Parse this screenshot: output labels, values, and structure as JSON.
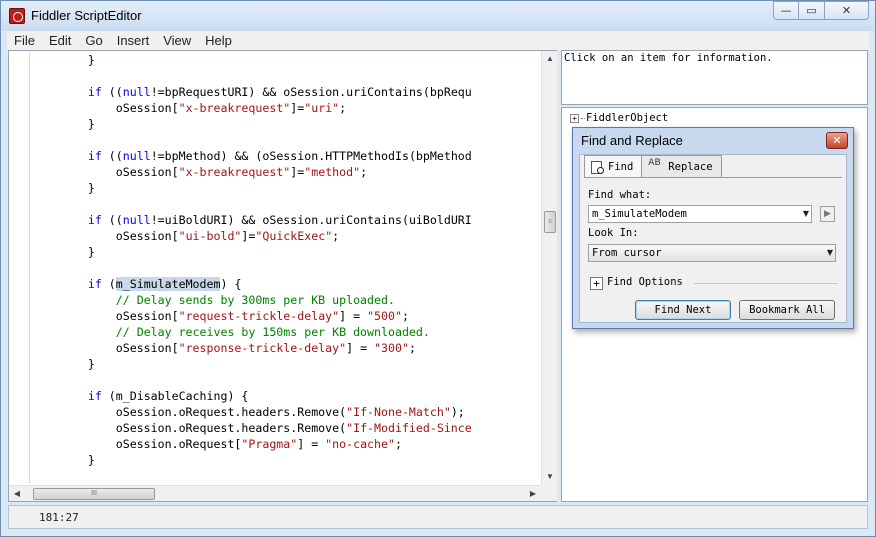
{
  "window": {
    "title": "Fiddler ScriptEditor",
    "caption": {
      "minimize": "—",
      "restore": "▭",
      "close": "✕"
    }
  },
  "menu": [
    "File",
    "Edit",
    "Go",
    "Insert",
    "View",
    "Help"
  ],
  "editor": {
    "lines": [
      [
        [
          "p",
          "        }"
        ]
      ],
      [
        [
          "p",
          ""
        ]
      ],
      [
        [
          "p",
          "        "
        ],
        [
          "kw",
          "if"
        ],
        [
          "p",
          " (("
        ],
        [
          "kw",
          "null"
        ],
        [
          "p",
          "!=bpRequestURI) && oSession.uriContains(bpRequ"
        ]
      ],
      [
        [
          "p",
          "            oSession["
        ],
        [
          "str",
          "\"x-breakrequest\""
        ],
        [
          "p",
          "]="
        ],
        [
          "str",
          "\"uri\""
        ],
        [
          "p",
          ";"
        ]
      ],
      [
        [
          "p",
          "        }"
        ]
      ],
      [
        [
          "p",
          ""
        ]
      ],
      [
        [
          "p",
          "        "
        ],
        [
          "kw",
          "if"
        ],
        [
          "p",
          " (("
        ],
        [
          "kw",
          "null"
        ],
        [
          "p",
          "!=bpMethod) && (oSession.HTTPMethodIs(bpMethod"
        ]
      ],
      [
        [
          "p",
          "            oSession["
        ],
        [
          "str",
          "\"x-breakrequest\""
        ],
        [
          "p",
          "]="
        ],
        [
          "str",
          "\"method\""
        ],
        [
          "p",
          ";"
        ]
      ],
      [
        [
          "p",
          "        }"
        ]
      ],
      [
        [
          "p",
          ""
        ]
      ],
      [
        [
          "p",
          "        "
        ],
        [
          "kw",
          "if"
        ],
        [
          "p",
          " (("
        ],
        [
          "kw",
          "null"
        ],
        [
          "p",
          "!=uiBoldURI) && oSession.uriContains(uiBoldURI"
        ]
      ],
      [
        [
          "p",
          "            oSession["
        ],
        [
          "str",
          "\"ui-bold\""
        ],
        [
          "p",
          "]="
        ],
        [
          "str",
          "\"QuickExec\""
        ],
        [
          "p",
          ";"
        ]
      ],
      [
        [
          "p",
          "        }"
        ]
      ],
      [
        [
          "p",
          ""
        ]
      ],
      [
        [
          "p",
          "        "
        ],
        [
          "kw",
          "if"
        ],
        [
          "p",
          " ("
        ],
        [
          "hl",
          "m_SimulateModem"
        ],
        [
          "p",
          ") {"
        ]
      ],
      [
        [
          "cmt",
          "            // Delay sends by 300ms per KB uploaded."
        ]
      ],
      [
        [
          "p",
          "            oSession["
        ],
        [
          "str",
          "\"request-trickle-delay\""
        ],
        [
          "p",
          "] = "
        ],
        [
          "str",
          "\"500\""
        ],
        [
          "p",
          ";"
        ]
      ],
      [
        [
          "cmt",
          "            // Delay receives by 150ms per KB downloaded."
        ]
      ],
      [
        [
          "p",
          "            oSession["
        ],
        [
          "str",
          "\"response-trickle-delay\""
        ],
        [
          "p",
          "] = "
        ],
        [
          "str",
          "\"300\""
        ],
        [
          "p",
          ";"
        ]
      ],
      [
        [
          "p",
          "        }"
        ]
      ],
      [
        [
          "p",
          ""
        ]
      ],
      [
        [
          "p",
          "        "
        ],
        [
          "kw",
          "if"
        ],
        [
          "p",
          " (m_DisableCaching) {"
        ]
      ],
      [
        [
          "p",
          "            oSession.oRequest.headers.Remove("
        ],
        [
          "str",
          "\"If-None-Match\""
        ],
        [
          "p",
          ");"
        ]
      ],
      [
        [
          "p",
          "            oSession.oRequest.headers.Remove("
        ],
        [
          "str",
          "\"If-Modified-Since"
        ]
      ],
      [
        [
          "p",
          "            oSession.oRequest["
        ],
        [
          "str",
          "\"Pragma\""
        ],
        [
          "p",
          "] = "
        ],
        [
          "str",
          "\"no-cache\""
        ],
        [
          "p",
          ";"
        ]
      ],
      [
        [
          "p",
          "        }"
        ]
      ],
      [
        [
          "p",
          ""
        ]
      ]
    ]
  },
  "scroll": {
    "up": "▲",
    "down": "▼",
    "left": "◀",
    "right": "▶",
    "grip_v": "≡",
    "grip_h": "III"
  },
  "info_panel": {
    "text": "Click on an item for information."
  },
  "tree": {
    "root": "FiddlerObject",
    "expander": "+"
  },
  "status": {
    "position": "181:27"
  },
  "dialog": {
    "title": "Find and Replace",
    "close": "✕",
    "tabs": {
      "find": "Find",
      "replace": "Replace"
    },
    "replace_icon_text": "AB",
    "find_what_label": "Find what:",
    "find_what_value": "m_SimulateModem",
    "side_button": "▶",
    "look_in_label": "Look In:",
    "look_in_value": "From cursor",
    "dropdown_arrow": "▼",
    "find_options_expander": "+",
    "find_options_label": "Find Options",
    "find_next_label": "Find Next",
    "bookmark_all_label": "Bookmark All"
  }
}
